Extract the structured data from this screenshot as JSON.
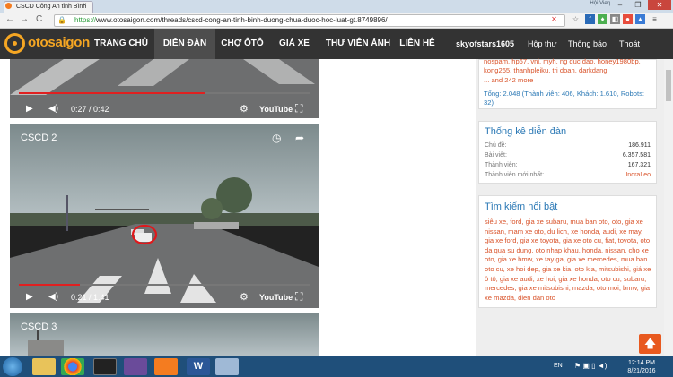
{
  "browser": {
    "tab_title": "CSCD Công An tỉnh Bình",
    "tab_close": "×",
    "user_label": "Hội Vieq",
    "win_controls": [
      "–",
      "❐",
      "✕"
    ],
    "nav_back": "←",
    "nav_forward": "→",
    "nav_reload": "C",
    "url_https": "https://",
    "url_rest": "www.otosaigon.com/threads/cscd-cong-an-tinh-binh-duong-chua-duoc-hoc-luat-gt.8749896/"
  },
  "site": {
    "logo_text": "otosaigon",
    "nav": [
      "TRANG CHỦ",
      "DIỄN ĐÀN",
      "CHỢ ÔTÔ",
      "GIÁ XE",
      "THƯ VIỆN ẢNH",
      "LIÊN HỆ"
    ],
    "user": "skyofstars1605",
    "inbox": "Hộp thư",
    "alerts": "Thông báo",
    "logout": "Thoát"
  },
  "videos": [
    {
      "title": "",
      "time": "0:27 / 0:42",
      "progress": 0.64,
      "yt": "YouTube"
    },
    {
      "title": "CSCD 2",
      "time": "0:21 / 1:41",
      "progress": 0.21,
      "yt": "YouTube"
    },
    {
      "title": "CSCD 3"
    }
  ],
  "online": {
    "names_line1": "nospam, hp67, vni, myh, ng duc dao, honey1980bp,",
    "names_line2": "kong265, thanhpleiku, tri doan, darkdang",
    "more": "... and 242 more",
    "total_line1": "Tổng: 2.048 (Thành viên: 406, Khách: 1.610, Robots:",
    "total_line2": "32)"
  },
  "stats": {
    "title": "Thống kê diễn đàn",
    "rows": [
      {
        "label": "Chủ đề:",
        "value": "186.911"
      },
      {
        "label": "Bài viết:",
        "value": "6.357.581"
      },
      {
        "label": "Thành viên:",
        "value": "167.321"
      },
      {
        "label": "Thành viên mới nhất:",
        "value": "IndraLeo"
      }
    ]
  },
  "search": {
    "title": "Tìm kiếm nổi bật",
    "lines": [
      "siêu xe, ford, gia xe subaru, mua ban oto, oto, gia xe",
      "nissan, mam xe oto, du lich, xe honda, audi, xe may,",
      "gia xe ford, gia xe toyota, gia xe oto cu, fiat, toyota, oto",
      "da qua su dung, oto nhap khau, honda, nissan, cho xe",
      "oto, gia xe bmw, xe tay ga, gia xe mercedes, mua ban",
      "oto cu, xe hoi dep, gia xe kia, oto kia, mitsubishi, giá xe",
      "ô tô, gia xe audi, xe hoi, gia xe honda, oto cu, subaru,",
      "mercedes, gia xe mitsubishi, mazda, oto moi, bmw, gia",
      "xe mazda, dien dan oto"
    ]
  },
  "taskbar": {
    "lang": "EN",
    "time": "12:14 PM",
    "date": "8/21/2016"
  },
  "colors": {
    "accent": "#f5a623",
    "nav_bg": "#333333",
    "link": "#2a78b5",
    "tag": "#d9532a",
    "top_btn": "#e8591f"
  }
}
